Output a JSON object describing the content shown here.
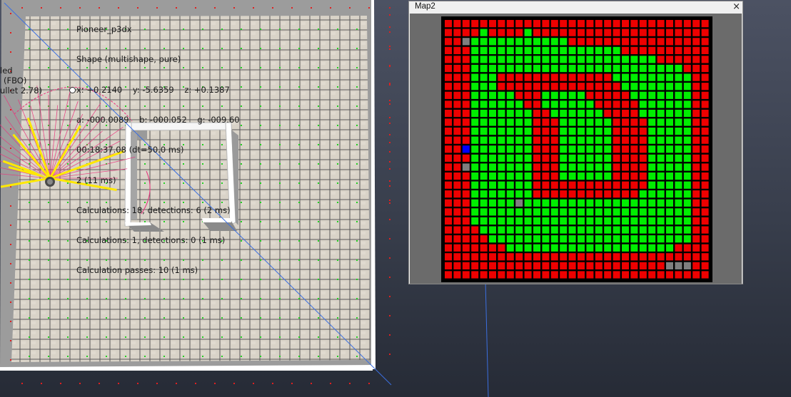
{
  "overlay": {
    "lines": [
      "Pioneer_p3dx",
      "Shape (multishape, pure)",
      "x: +0.2140    y: -5.6359    z: +0.1387",
      "a: -000.0089    b: -000.052    g: -009.60",
      "00:18:37.08 (dt=50.0 ms)",
      "2 (11 ms)",
      "Calculations: 18, detections: 6 (2 ms)",
      "Calculations: 1, detections: 0 (1 ms)",
      "Calculation passes: 10 (1 ms)"
    ],
    "left_fragments": [
      "led",
      "(FBO)",
      "ullet 2.78)"
    ]
  },
  "map_window": {
    "title": "Map2",
    "close_glyph": "×",
    "legend_colors": {
      "free": "#00ee00",
      "occupied": "#ee0000",
      "unknown": "#7f7f7f",
      "robot": "#0000ff",
      "border": "#000000"
    },
    "grid": [
      "RRRRRRRRRRRRRRRRRRRRRRRRRRRRRR",
      "RRRRGRRRRGRRRRRRRRRRRRRRRRRRRR",
      "RRUGGGGGGGGGGGRRRRRRRRRRRRRRRR",
      "RRRGGGGGGGGGGGGGGGGGRRRRRRRRRR",
      "RRRGGGGGGGGGGGGGGGGGGGGGRRRRRR",
      "RRRGGGGGGGGGGGGGGGGGGGGGGGGRRR",
      "RRRGGGRRRRRRRRRRRRRGGGGGGGGGRR",
      "RRRGGGRRRRRRRRRRRRRRGGGGGGGGRR",
      "RRRGGGGGRRRGGGGGRRRRRGGGGGGGRR",
      "RRRGGGGGGRRGGGGGGRRRRRGGGGGGRR",
      "RRRGGGGGGGRRGGGGGGRRRRGGGGGGRR",
      "RRRGGGGGGGRRRGGGGGGRRRRGGGGGRR",
      "RRRGGGGGGGRRRGGGGGGRRRRGGGGGRR",
      "RRRGGGGGGGRRRGGGGGGRRRRGGGGGRR",
      "RRBGGGGGGGRRRGGGGGGRRRRGGGGGRR",
      "RRRGGGGGGGRRRGGGGGGRRRRGGGGGRR",
      "RRUGGGGGGGRRRGGGGGGRRRRGGGGGRR",
      "RRRGGGGGGGRRRGGGGGGRRRRGGGGGRR",
      "RRRGGGGGGGRRRRRRRRRRRRRGGGGGRR",
      "RRRGGGGGGGRRRRRRRRRRRRGGGGGGRR",
      "RRRGGGGGUGGGGGGGGGGGGGGGGGGGRR",
      "RRRGGGGGGGGGGGGGGGGGGGGGGGGGRR",
      "RRRGGGGGGGGGGGGGGGGGGGGGGGGGRR",
      "RRRRGGGGGGGGGGGGGGGGGGGGGGGGRR",
      "RRRRRGGGGGGGGGGGGGGGGGGGGGGGRR",
      "RRRRRRRGGGGGGGGGGGGGGGGGGGRRRR",
      "RRRRRRRRRRRRRRRRRRRRRRRRRRRRRR",
      "RRRRRRRRRRRRRRRRRRRRRRRRRUUURR",
      "RRRRRRRRRRRRRRRRRRRRRRRRRRRRRR"
    ]
  }
}
